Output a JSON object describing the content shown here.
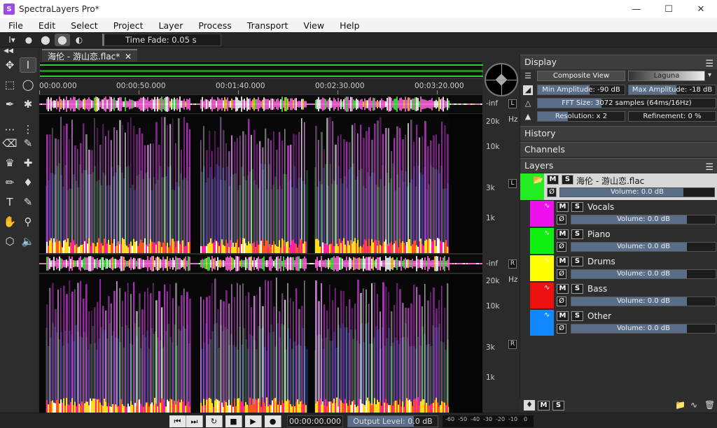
{
  "window": {
    "title": "SpectraLayers Pro*",
    "controls": [
      "minimize",
      "maximize",
      "close"
    ]
  },
  "menu": [
    "File",
    "Edit",
    "Select",
    "Project",
    "Layer",
    "Process",
    "Transport",
    "View",
    "Help"
  ],
  "toolbar": {
    "time_fade": "Time Fade: 0.05 s"
  },
  "document": {
    "tab_label": "海伦 - 游山恋.flac*",
    "timeline_ticks": [
      "00:00.000",
      "00:00:50.000",
      "00:01:40.000",
      "00:02:30.000",
      "00:03:20.000"
    ],
    "channel_left": "L",
    "channel_right": "R",
    "level_label": "-inf",
    "freq_unit": "Hz",
    "freq_labels": [
      "20k",
      "10k",
      "3k",
      "1k"
    ]
  },
  "panels": {
    "display": {
      "title": "Display",
      "composite_view": "Composite View",
      "colormap": "Laguna",
      "min_amplitude": "Min Amplitude: -90 dB",
      "max_amplitude": "Max Amplitude: -18 dB",
      "fft_size": "FFT Size: 3072 samples (64ms/16Hz)",
      "resolution": "Resolution: x 2",
      "refinement": "Refinement: 0 %"
    },
    "history": {
      "title": "History"
    },
    "channels": {
      "title": "Channels"
    },
    "layers": {
      "title": "Layers",
      "mute": "M",
      "solo": "S",
      "phase": "Ø",
      "parent": {
        "name": "海伦 - 游山恋.flac",
        "volume": "Volume: 0.0 dB",
        "color": "#22ee22"
      },
      "items": [
        {
          "name": "Vocals",
          "volume": "Volume: 0.0 dB",
          "color": "#ee11ee"
        },
        {
          "name": "Piano",
          "volume": "Volume: 0.0 dB",
          "color": "#11ee11"
        },
        {
          "name": "Drums",
          "volume": "Volume: 0.0 dB",
          "color": "#ffff00"
        },
        {
          "name": "Bass",
          "volume": "Volume: 0.0 dB",
          "color": "#ee1111"
        },
        {
          "name": "Other",
          "volume": "Volume: 0.0 dB",
          "color": "#1188ff"
        }
      ]
    }
  },
  "transport": {
    "time": "00:00:00.000",
    "output_level": "Output Level: 0.0 dB",
    "meter_labels": [
      "-60",
      "-50",
      "-40",
      "-30",
      "-20",
      "-10",
      "0"
    ]
  }
}
